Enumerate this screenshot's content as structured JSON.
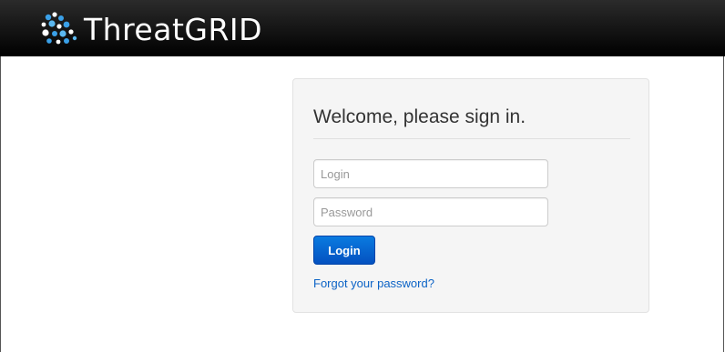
{
  "header": {
    "brand": "ThreatGRID",
    "logo_icon": "threatgrid-logo-icon"
  },
  "signin": {
    "title": "Welcome, please sign in.",
    "login_placeholder": "Login",
    "login_value": "",
    "password_placeholder": "Password",
    "password_value": "",
    "login_button_label": "Login",
    "forgot_link": "Forgot your password?"
  },
  "colors": {
    "header_bg": "#000000",
    "button_blue": "#0a6fd8",
    "link_blue": "#0c63c6",
    "card_bg": "#f5f5f5"
  }
}
